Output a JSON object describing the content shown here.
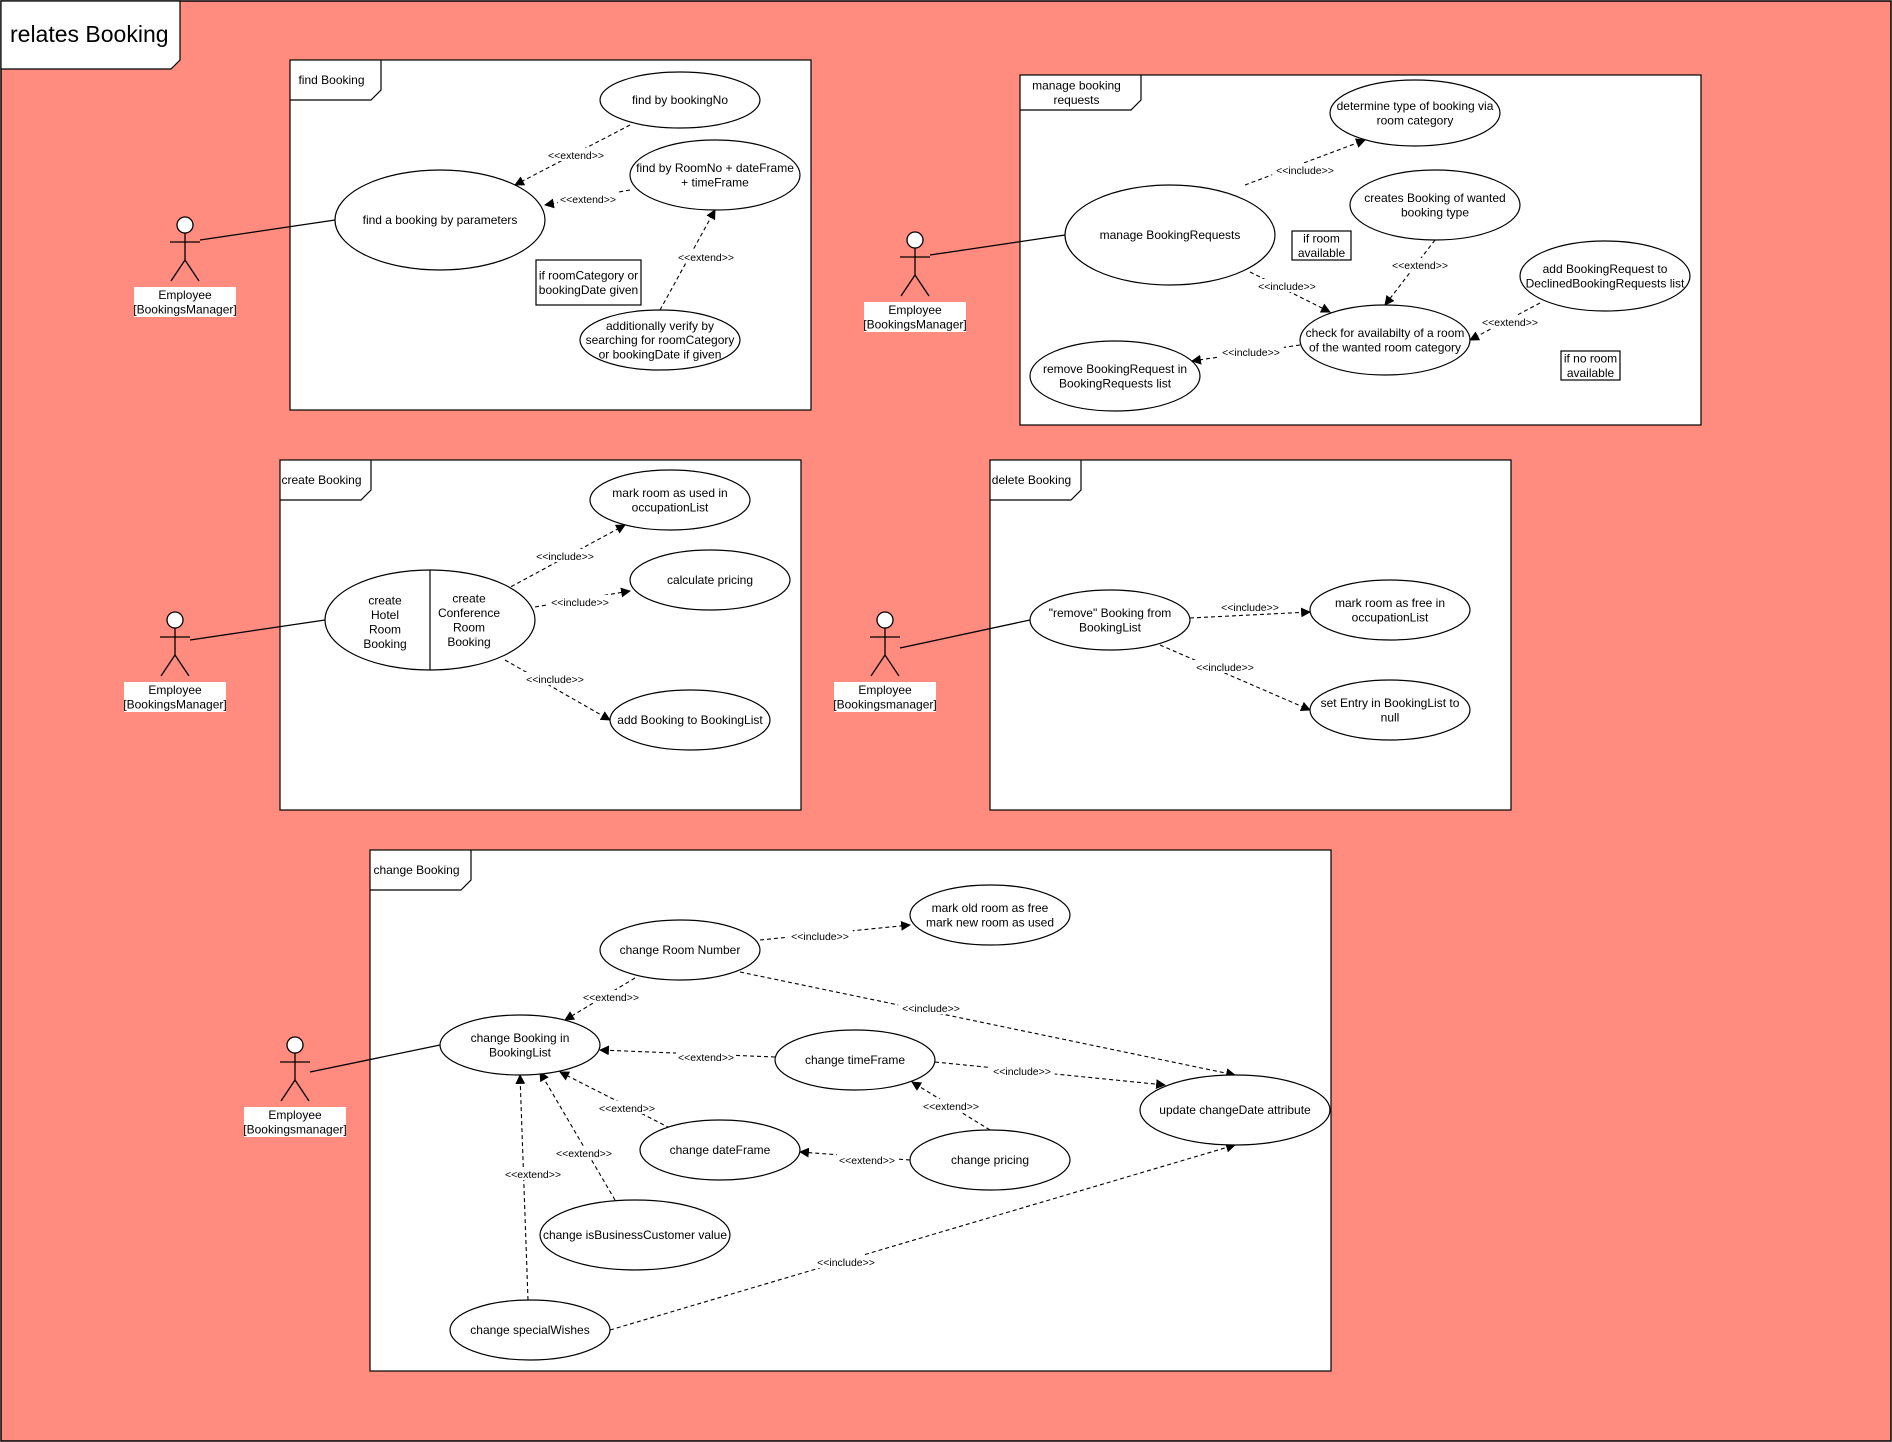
{
  "title": "relates Booking",
  "colors": {
    "background": "#FF8C7E",
    "frame_fill": "#FFFFFF",
    "stroke": "#000000"
  },
  "frames": {
    "find": "find Booking",
    "manage": [
      "manage booking",
      "requests"
    ],
    "create": "create Booking",
    "delete": "delete Booking",
    "change": "change Booking"
  },
  "actors": {
    "a1": [
      "Employee",
      "[BookingsManager]"
    ],
    "a2": [
      "Employee",
      "[BookingsManager]"
    ],
    "a3": [
      "Employee",
      "[BookingsManager]"
    ],
    "a4": [
      "Employee",
      "[Bookingsmanager]"
    ],
    "a5": [
      "Employee",
      "[Bookingsmanager]"
    ]
  },
  "usecases": {
    "find_by_params": [
      "find a booking by parameters"
    ],
    "find_by_no": [
      "find by bookingNo"
    ],
    "find_by_room": [
      "find by RoomNo + dateFrame",
      "+ timeFrame"
    ],
    "verify": [
      "additionally verify by",
      "searching for roomCategory",
      "or bookingDate if given"
    ],
    "determine_type": [
      "determine type of booking via",
      "room category"
    ],
    "manage_requests": [
      "manage BookingRequests"
    ],
    "creates_booking": [
      "creates Booking of wanted",
      "booking type"
    ],
    "add_declined": [
      "add BookingRequest to",
      "DeclinedBookingRequests list"
    ],
    "check_avail": [
      "check for availabilty of a room",
      "of the wanted room category"
    ],
    "remove_request": [
      "remove BookingRequest in",
      "BookingRequests list"
    ],
    "mark_used": [
      "mark room as used in",
      "occupationList"
    ],
    "calc_pricing": [
      "calculate pricing"
    ],
    "add_booking": [
      "add Booking to BookingList"
    ],
    "create_hotel": [
      "create",
      "Hotel",
      "Room",
      "Booking"
    ],
    "create_conf": [
      "create",
      "Conference",
      "Room",
      "Booking"
    ],
    "remove_booking": [
      "\"remove\" Booking from",
      "BookingList"
    ],
    "mark_free": [
      "mark room as free in",
      "occupationList"
    ],
    "set_null": [
      "set Entry in BookingList to",
      "null"
    ],
    "mark_old_new": [
      "mark old room as free",
      "mark new room as used"
    ],
    "change_room": [
      "change Room Number"
    ],
    "change_in_list": [
      "change Booking in",
      "BookingList"
    ],
    "change_time": [
      "change timeFrame"
    ],
    "update_date": [
      "update changeDate attribute"
    ],
    "change_date": [
      "change dateFrame"
    ],
    "change_pricing": [
      "change pricing"
    ],
    "change_business": [
      "change isBusinessCustomer value"
    ],
    "change_wishes": [
      "change specialWishes"
    ]
  },
  "notes": {
    "room_category": [
      "if roomCategory or",
      "bookingDate given"
    ],
    "room_available": [
      "if room",
      "available"
    ],
    "no_room": [
      "if no room",
      "available"
    ]
  },
  "stereotypes": {
    "extend": "<<extend>>",
    "include": "<<include>>"
  }
}
